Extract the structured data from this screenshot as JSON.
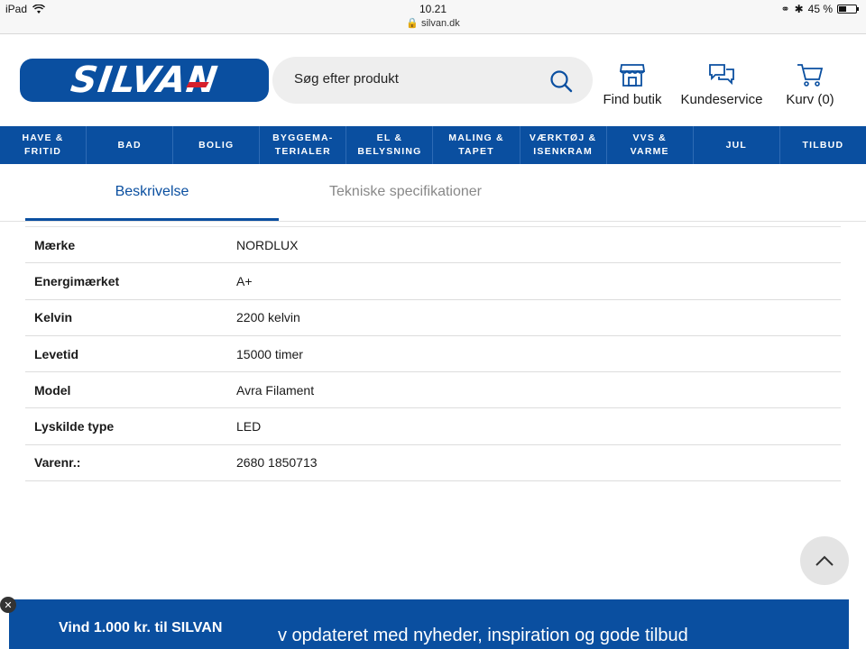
{
  "status_bar": {
    "device": "iPad",
    "time": "10.21",
    "url": "silvan.dk",
    "battery": "45 %",
    "battery_level": 0.45
  },
  "header": {
    "logo_text": "SILVAN",
    "search": {
      "placeholder": "Søg efter produkt"
    },
    "links": [
      {
        "label": "Find butik",
        "icon": "store-icon"
      },
      {
        "label": "Kundeservice",
        "icon": "chat-icon"
      },
      {
        "label": "Kurv (0)",
        "icon": "cart-icon"
      }
    ]
  },
  "nav": {
    "items": [
      "HAVE &\nFRITID",
      "BAD",
      "BOLIG",
      "BYGGEMA-\nTERIALER",
      "EL &\nBELYSNING",
      "MALING &\nTAPET",
      "VÆRKTØJ &\nISENKRAM",
      "VVS &\nVARME",
      "JUL",
      "TILBUD"
    ]
  },
  "tabs": {
    "active": "Beskrivelse",
    "inactive": "Tekniske specifikationer"
  },
  "specs": [
    {
      "label": "Mærke",
      "value": "NORDLUX"
    },
    {
      "label": "Energimærket",
      "value": "A+"
    },
    {
      "label": "Kelvin",
      "value": "2200 kelvin"
    },
    {
      "label": "Levetid",
      "value": "15000 timer"
    },
    {
      "label": "Model",
      "value": "Avra Filament"
    },
    {
      "label": "Lyskilde type",
      "value": "LED"
    },
    {
      "label": "Varenr.:",
      "value": "2680 1850713"
    }
  ],
  "banner": {
    "title": "Vind 1.000 kr. til SILVAN",
    "text": "v opdateret med nyheder, inspiration og gode tilbud"
  },
  "colors": {
    "brand_blue": "#0a4fa0",
    "accent_red": "#d6202c"
  }
}
